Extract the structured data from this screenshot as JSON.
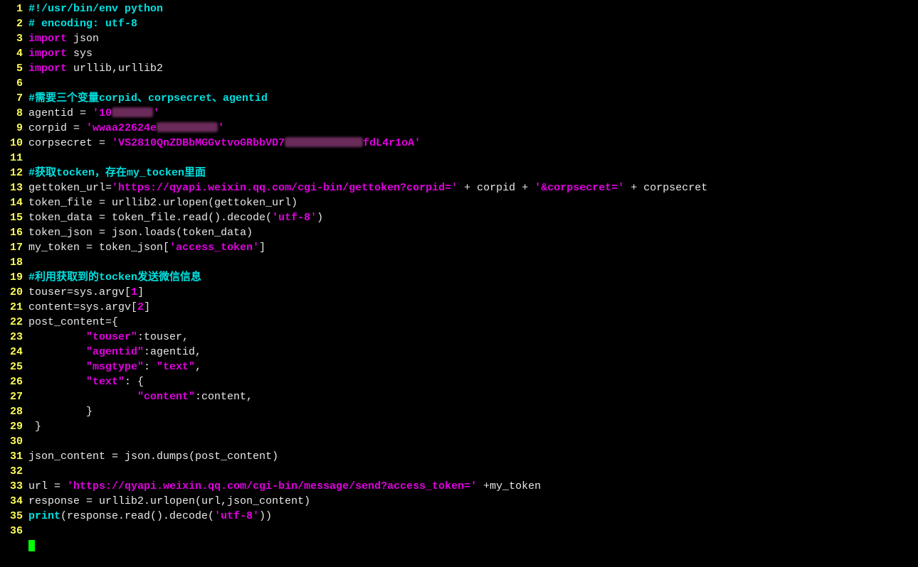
{
  "lines": [
    {
      "n": "1",
      "html": "<span class='c-comment'>#!/usr/bin/env python</span>"
    },
    {
      "n": "2",
      "html": "<span class='c-comment'># encoding: utf-8</span>"
    },
    {
      "n": "3",
      "html": "<span class='c-keyword'>import</span><span class='c-ident'> json</span>"
    },
    {
      "n": "4",
      "html": "<span class='c-keyword'>import</span><span class='c-ident'> sys</span>"
    },
    {
      "n": "5",
      "html": "<span class='c-keyword'>import</span><span class='c-ident'> urllib,urllib2</span>"
    },
    {
      "n": "6",
      "html": ""
    },
    {
      "n": "7",
      "html": "<span class='c-comment'>#需要三个变量corpid、corpsecret、agentid</span>"
    },
    {
      "n": "8",
      "html": "<span class='c-ident'>agentid </span><span class='c-op'>=</span><span class='c-ident'> </span><span class='c-string'>'10</span><span class='redact' style='width:58px'></span><span class='c-string'>'</span>"
    },
    {
      "n": "9",
      "html": "<span class='c-ident'>corpid </span><span class='c-op'>=</span><span class='c-ident'> </span><span class='c-string'>'wwaa22624e</span><span class='redact' style='width:86px'></span><span class='c-string'>'</span>"
    },
    {
      "n": "10",
      "html": "<span class='c-ident'>corpsecret </span><span class='c-op'>=</span><span class='c-ident'> </span><span class='c-string'>'VS2810QnZDBbMGGvtvoGRbbVD7</span><span class='redact' style='width:110px'></span><span class='c-string'>fdL4r1oA'</span>"
    },
    {
      "n": "11",
      "html": ""
    },
    {
      "n": "12",
      "html": "<span class='c-comment'>#获取tocken，存在my_tocken里面</span>"
    },
    {
      "n": "13",
      "html": "<span class='c-ident'>gettoken_url</span><span class='c-op'>=</span><span class='c-string'>'https://qyapi.weixin.qq.com/cgi-bin/gettoken?corpid='</span><span class='c-ident'> </span><span class='c-op'>+</span><span class='c-ident'> corpid </span><span class='c-op'>+</span><span class='c-ident'> </span><span class='c-string'>'&amp;corpsecret='</span><span class='c-ident'> </span><span class='c-op'>+</span><span class='c-ident'> corpsecret</span>"
    },
    {
      "n": "14",
      "html": "<span class='c-ident'>token_file </span><span class='c-op'>=</span><span class='c-ident'> urllib2.urlopen(gettoken_url)</span>"
    },
    {
      "n": "15",
      "html": "<span class='c-ident'>token_data </span><span class='c-op'>=</span><span class='c-ident'> token_file.read().decode(</span><span class='c-string'>'utf-8'</span><span class='c-ident'>)</span>"
    },
    {
      "n": "16",
      "html": "<span class='c-ident'>token_json </span><span class='c-op'>=</span><span class='c-ident'> json.loads(token_data)</span>"
    },
    {
      "n": "17",
      "html": "<span class='c-ident'>my_token </span><span class='c-op'>=</span><span class='c-ident'> token_json[</span><span class='c-string'>'access_token'</span><span class='c-ident'>]</span>"
    },
    {
      "n": "18",
      "html": ""
    },
    {
      "n": "19",
      "html": "<span class='c-comment'>#利用获取到的tocken发送微信信息</span>"
    },
    {
      "n": "20",
      "html": "<span class='c-ident'>touser</span><span class='c-op'>=</span><span class='c-ident'>sys.argv[</span><span class='c-number'>1</span><span class='c-ident'>]</span>"
    },
    {
      "n": "21",
      "html": "<span class='c-ident'>content</span><span class='c-op'>=</span><span class='c-ident'>sys.argv[</span><span class='c-number'>2</span><span class='c-ident'>]</span>"
    },
    {
      "n": "22",
      "html": "<span class='c-ident'>post_content</span><span class='c-op'>=</span><span class='c-ident'>{</span>"
    },
    {
      "n": "23",
      "html": "<span class='c-ident'>         </span><span class='c-string'>\"touser\"</span><span class='c-ident'>:touser,</span>"
    },
    {
      "n": "24",
      "html": "<span class='c-ident'>         </span><span class='c-string'>\"agentid\"</span><span class='c-ident'>:agentid,</span>"
    },
    {
      "n": "25",
      "html": "<span class='c-ident'>         </span><span class='c-string'>\"msgtype\"</span><span class='c-ident'>: </span><span class='c-string'>\"text\"</span><span class='c-ident'>,</span>"
    },
    {
      "n": "26",
      "html": "<span class='c-ident'>         </span><span class='c-string'>\"text\"</span><span class='c-ident'>: {</span>"
    },
    {
      "n": "27",
      "html": "<span class='c-ident'>                 </span><span class='c-string'>\"content\"</span><span class='c-ident'>:content,</span>"
    },
    {
      "n": "28",
      "html": "<span class='c-ident'>         }</span>"
    },
    {
      "n": "29",
      "html": "<span class='c-ident'> }</span>"
    },
    {
      "n": "30",
      "html": ""
    },
    {
      "n": "31",
      "html": "<span class='c-ident'>json_content </span><span class='c-op'>=</span><span class='c-ident'> json.dumps(post_content)</span>"
    },
    {
      "n": "32",
      "html": ""
    },
    {
      "n": "33",
      "html": "<span class='c-ident'>url </span><span class='c-op'>=</span><span class='c-ident'> </span><span class='c-string'>'https://qyapi.weixin.qq.com/cgi-bin/message/send?access_token='</span><span class='c-ident'> </span><span class='c-op'>+</span><span class='c-ident'>my_token</span>"
    },
    {
      "n": "34",
      "html": "<span class='c-ident'>response </span><span class='c-op'>=</span><span class='c-ident'> urllib2.urlopen(url,json_content)</span>"
    },
    {
      "n": "35",
      "html": "<span class='c-builtin'>print</span><span class='c-ident'>(response.read().decode(</span><span class='c-string'>'utf-8'</span><span class='c-ident'>))</span>"
    },
    {
      "n": "36",
      "html": ""
    }
  ]
}
